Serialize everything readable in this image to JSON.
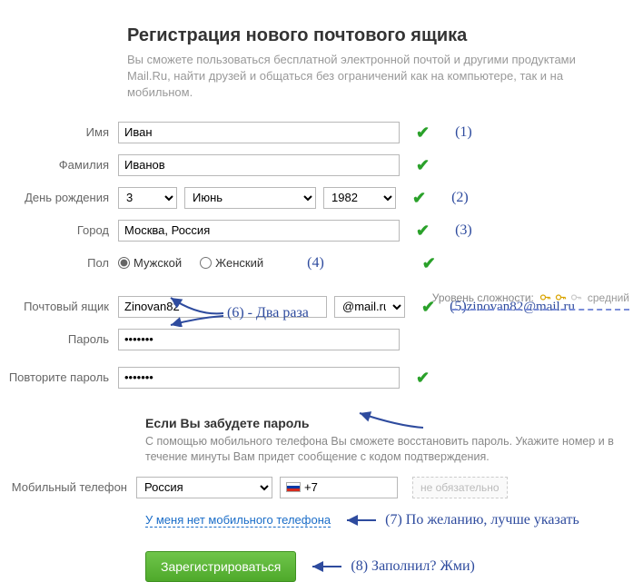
{
  "title": "Регистрация нового почтового ящика",
  "subtitle": "Вы сможете пользоваться бесплатной электронной почтой и другими продуктами Mail.Ru, найти друзей и общаться без ограничений как на компьютере, так и на мобильном.",
  "labels": {
    "firstname": "Имя",
    "lastname": "Фамилия",
    "birthday": "День рождения",
    "city": "Город",
    "gender": "Пол",
    "mailbox": "Почтовый ящик",
    "password": "Пароль",
    "password2": "Повторите пароль",
    "phone": "Мобильный телефон"
  },
  "values": {
    "firstname": "Иван",
    "lastname": "Иванов",
    "day": "3",
    "month": "Июнь",
    "year": "1982",
    "city": "Москва, Россия",
    "gender_male": "Мужской",
    "gender_female": "Женский",
    "mailbox_user": "Zinovan82",
    "mailbox_domain": "@mail.ru",
    "password": "•••••••",
    "password2": "•••••••",
    "phone_country": "Россия",
    "phone_code": "+7"
  },
  "forgot": {
    "heading": "Если Вы забудете пароль",
    "text": "С помощью мобильного телефона Вы сможете восстановить пароль. Укажите номер и в течение минуты Вам придет сообщение с кодом подтверждения."
  },
  "optional_text": "не обязательно",
  "no_phone_link": "У меня нет мобильного телефона",
  "submit_btn": "Зарегистрироваться",
  "strength": {
    "label": "Уровень сложности:",
    "value": "средний"
  },
  "annotations": {
    "a1": "(1)",
    "a2": "(2)",
    "a3": "(3)",
    "a4": "(4)",
    "a5": "(5)",
    "a5email": "zinovan82@mail.ru",
    "a6": "(6) - Два раза",
    "a7": "(7) По желанию, лучше указать",
    "a8": "(8) Заполнил? Жми)"
  }
}
